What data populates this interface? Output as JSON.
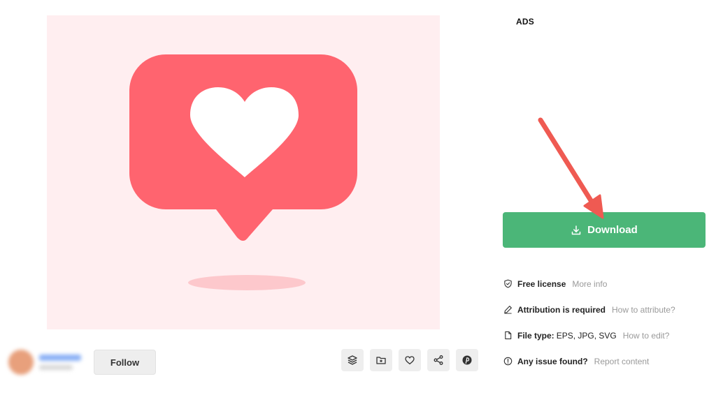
{
  "ads_label": "ADS",
  "author": {
    "follow_label": "Follow"
  },
  "actions": [
    {
      "icon": "layers-icon"
    },
    {
      "icon": "add-to-collection-icon"
    },
    {
      "icon": "heart-icon"
    },
    {
      "icon": "share-icon"
    },
    {
      "icon": "pinterest-icon"
    }
  ],
  "download": {
    "label": "Download"
  },
  "info": {
    "license": {
      "label": "Free license",
      "link": "More info"
    },
    "attribution": {
      "label": "Attribution is required",
      "link": "How to attribute?"
    },
    "file_type": {
      "label": "File type:",
      "value": "EPS, JPG, SVG",
      "link": "How to edit?"
    },
    "issue": {
      "label": "Any issue found?",
      "link": "Report content"
    }
  },
  "colors": {
    "accent_green": "#4bb678",
    "bubble_red": "#ff646f",
    "preview_bg": "#ffeef0",
    "arrow_red": "#ef5a52"
  }
}
